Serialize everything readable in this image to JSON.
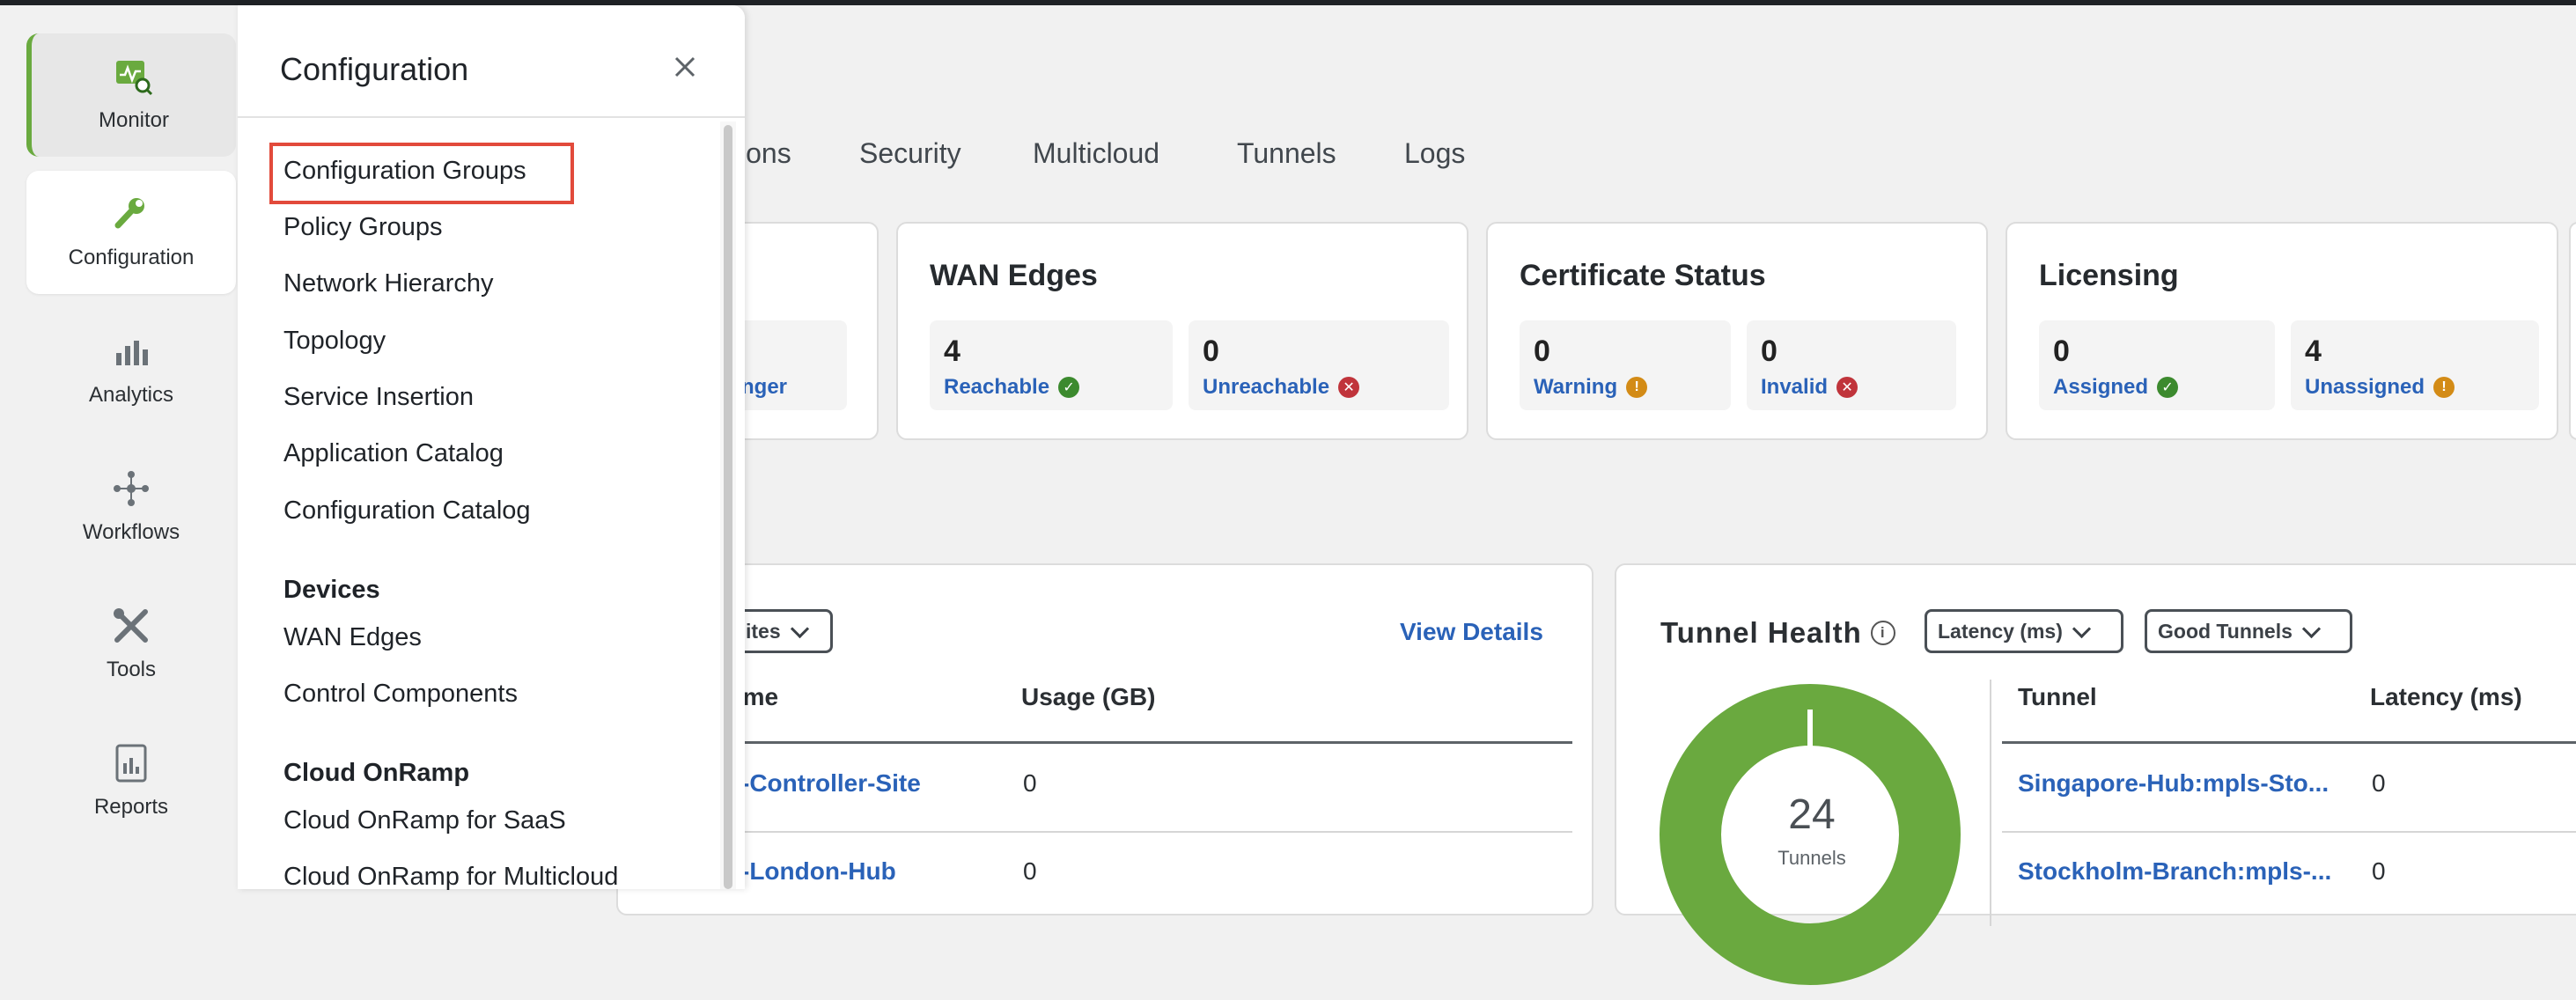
{
  "rail": {
    "items": [
      {
        "label": "Monitor",
        "icon": "monitor-icon"
      },
      {
        "label": "Configuration",
        "icon": "wrench-icon"
      },
      {
        "label": "Analytics",
        "icon": "bar-chart-icon"
      },
      {
        "label": "Workflows",
        "icon": "workflow-icon"
      },
      {
        "label": "Tools",
        "icon": "tools-icon"
      },
      {
        "label": "Reports",
        "icon": "reports-icon"
      }
    ]
  },
  "tabs": [
    "ions",
    "Security",
    "Multicloud",
    "Tunnels",
    "Logs"
  ],
  "cards": {
    "partial": {
      "label_fragment": "nger"
    },
    "wan_edges": {
      "title": "WAN Edges",
      "stats": [
        {
          "value": "4",
          "label": "Reachable",
          "status": "ok"
        },
        {
          "value": "0",
          "label": "Unreachable",
          "status": "error"
        }
      ]
    },
    "certificate_status": {
      "title": "Certificate Status",
      "stats": [
        {
          "value": "0",
          "label": "Warning",
          "status": "warning"
        },
        {
          "value": "0",
          "label": "Invalid",
          "status": "error"
        }
      ]
    },
    "licensing": {
      "title": "Licensing",
      "stats": [
        {
          "value": "0",
          "label": "Assigned",
          "status": "ok"
        },
        {
          "value": "4",
          "label": "Unassigned",
          "status": "warning"
        }
      ]
    }
  },
  "sites_panel": {
    "dropdown_fragment": "ites",
    "view_details": "View Details",
    "columns": [
      "ame",
      "Usage (GB)"
    ],
    "rows": [
      {
        "name": "-Controller-Site",
        "usage": "0"
      },
      {
        "name": "-London-Hub",
        "usage": "0"
      }
    ]
  },
  "tunnel_health": {
    "title": "Tunnel Health",
    "dropdown_metric": "Latency (ms)",
    "dropdown_filter": "Good Tunnels",
    "donut_value": "24",
    "donut_label": "Tunnels",
    "columns": [
      "Tunnel",
      "Latency (ms)"
    ],
    "rows": [
      {
        "tunnel": "Singapore-Hub:mpls-Sto...",
        "latency": "0"
      },
      {
        "tunnel": "Stockholm-Branch:mpls-...",
        "latency": "0"
      }
    ],
    "colors": {
      "good": "#6aa93f"
    }
  },
  "config_panel": {
    "title": "Configuration",
    "items": [
      "Configuration Groups",
      "Policy Groups",
      "Network Hierarchy",
      "Topology",
      "Service Insertion",
      "Application Catalog",
      "Configuration Catalog"
    ],
    "sections": [
      {
        "title": "Devices",
        "items": [
          "WAN Edges",
          "Control Components"
        ]
      },
      {
        "title": "Cloud OnRamp",
        "items": [
          "Cloud OnRamp for SaaS",
          "Cloud OnRamp for Multicloud"
        ]
      }
    ],
    "highlighted_item": "Configuration Groups"
  },
  "colors": {
    "accent": "#2a62b8",
    "brand_green": "#6aaa3f",
    "highlight": "#e24a3b"
  }
}
